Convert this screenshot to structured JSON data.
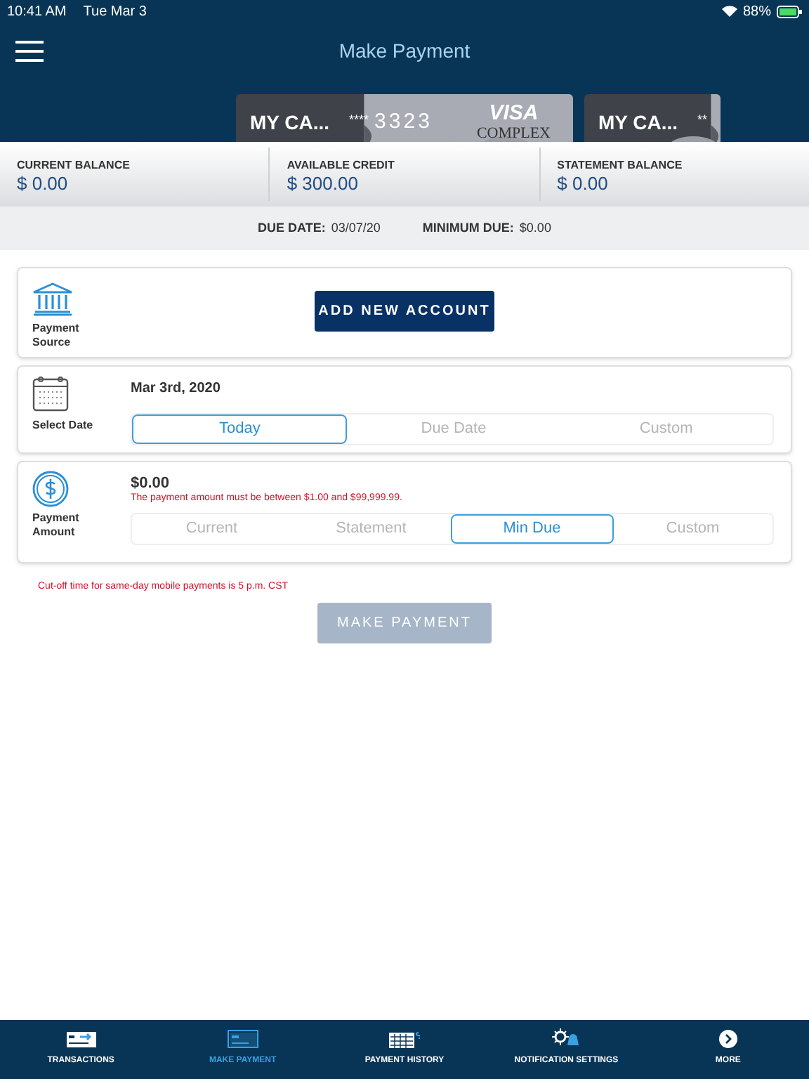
{
  "status_bar": {
    "time": "10:41 AM",
    "date": "Tue Mar 3",
    "battery": "88%"
  },
  "header": {
    "title": "Make Payment"
  },
  "cards": [
    {
      "name": "MY CA...",
      "mask": "****",
      "last4": "3323",
      "brand": "VISA",
      "tier": "COMPLEX"
    },
    {
      "name": "MY CA...",
      "mask": "**"
    }
  ],
  "balances": [
    {
      "label": "CURRENT BALANCE",
      "value": "$ 0.00"
    },
    {
      "label": "AVAILABLE CREDIT",
      "value": "$ 300.00"
    },
    {
      "label": "STATEMENT BALANCE",
      "value": "$ 0.00"
    }
  ],
  "due": [
    {
      "label": "DUE DATE:",
      "value": "03/07/20"
    },
    {
      "label": "MINIMUM DUE:",
      "value": "$0.00"
    }
  ],
  "payment_source": {
    "label": "Payment Source",
    "button": "ADD NEW ACCOUNT"
  },
  "select_date": {
    "label": "Select Date",
    "date": "Mar 3rd, 2020",
    "options": [
      {
        "label": "Today",
        "selected": true
      },
      {
        "label": "Due Date",
        "selected": false
      },
      {
        "label": "Custom",
        "selected": false
      }
    ]
  },
  "payment_amount": {
    "label": "Payment Amount",
    "amount": "$0.00",
    "error": "The payment amount must be between $1.00 and $99,999.99.",
    "options": [
      {
        "label": "Current",
        "selected": false
      },
      {
        "label": "Statement",
        "selected": false
      },
      {
        "label": "Min Due",
        "selected": true
      },
      {
        "label": "Custom",
        "selected": false
      }
    ]
  },
  "cutoff_note": "Cut-off time for same-day mobile payments is 5 p.m. CST",
  "make_payment_button": {
    "label": "MAKE PAYMENT",
    "disabled": true
  },
  "tab_bar": [
    {
      "label": "TRANSACTIONS",
      "kind": "transactions",
      "selected": false
    },
    {
      "label": "MAKE PAYMENT",
      "kind": "payment",
      "selected": true
    },
    {
      "label": "PAYMENT HISTORY",
      "kind": "history",
      "selected": false
    },
    {
      "label": "NOTIFICATION SETTINGS",
      "kind": "notifications",
      "selected": false
    },
    {
      "label": "MORE",
      "kind": "more",
      "selected": false
    }
  ]
}
